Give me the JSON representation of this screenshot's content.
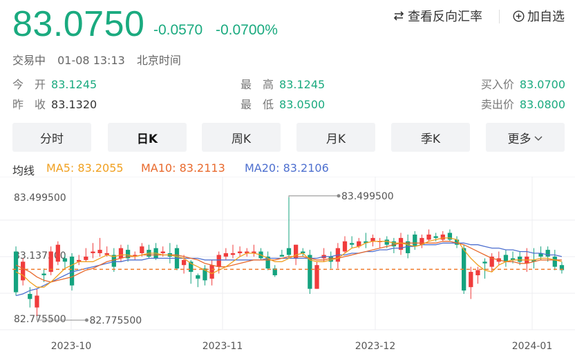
{
  "header": {
    "price": "83.0750",
    "change": "-0.0570",
    "change_pct": "-0.0700%",
    "actions": {
      "reverse_rate": "查看反向汇率",
      "add_watch": "加自选"
    },
    "status": "交易中",
    "datetime": "01-08 13:13",
    "timezone": "北京时间"
  },
  "quote": {
    "open_label": "今　开",
    "open": "83.1245",
    "prev_close_label": "昨　收",
    "prev_close": "83.1320",
    "high_label": "最　高",
    "high": "83.1245",
    "low_label": "最　低",
    "low": "83.0500",
    "bid_label": "买入价",
    "bid": "83.0700",
    "ask_label": "卖出价",
    "ask": "83.0800"
  },
  "tabs": [
    "分时",
    "日K",
    "周K",
    "月K",
    "季K",
    "更多"
  ],
  "active_tab": "日K",
  "ma_legend": {
    "title": "均线",
    "ma5": "MA5: 83.2055",
    "ma10": "MA10: 83.2113",
    "ma20": "MA20: 83.2106"
  },
  "colors": {
    "up": "#f03c3c",
    "down": "#14a37f",
    "ma5": "#f0a020",
    "ma10": "#e8692c",
    "ma20": "#4d6fcf",
    "brand": "#1aaa7f"
  },
  "chart_data": {
    "type": "candlestick",
    "ylim": [
      82.7755,
      83.4995
    ],
    "y_tick_labels": [
      "83.499500",
      "83.137500",
      "82.775500"
    ],
    "x_tick_labels": [
      "2023-10",
      "2023-11",
      "2023-12",
      "2024-01"
    ],
    "annotations": {
      "max_label": "83.499500",
      "min_label": "82.775500"
    },
    "reference_price": 83.075,
    "candles": [
      {
        "o": 83.18,
        "c": 82.94,
        "h": 83.21,
        "l": 82.92
      },
      {
        "o": 83.01,
        "c": 83.12,
        "h": 83.14,
        "l": 82.98
      },
      {
        "o": 82.93,
        "c": 82.9,
        "h": 82.97,
        "l": 82.85
      },
      {
        "o": 82.85,
        "c": 82.92,
        "h": 82.96,
        "l": 82.8
      },
      {
        "o": 83.05,
        "c": 83.04,
        "h": 83.08,
        "l": 83.0
      },
      {
        "o": 83.06,
        "c": 83.18,
        "h": 83.21,
        "l": 83.04
      },
      {
        "o": 83.12,
        "c": 83.22,
        "h": 83.24,
        "l": 83.1
      },
      {
        "o": 83.14,
        "c": 83.12,
        "h": 83.16,
        "l": 83.08
      },
      {
        "o": 83.15,
        "c": 82.98,
        "h": 83.17,
        "l": 82.95
      },
      {
        "o": 83.12,
        "c": 83.13,
        "h": 83.16,
        "l": 83.1
      },
      {
        "o": 83.13,
        "c": 83.15,
        "h": 83.2,
        "l": 83.12
      },
      {
        "o": 83.17,
        "c": 83.18,
        "h": 83.23,
        "l": 83.14
      },
      {
        "o": 83.17,
        "c": 83.19,
        "h": 83.26,
        "l": 83.15
      },
      {
        "o": 83.16,
        "c": 83.17,
        "h": 83.21,
        "l": 83.15
      },
      {
        "o": 83.16,
        "c": 83.09,
        "h": 83.2,
        "l": 83.06
      },
      {
        "o": 83.14,
        "c": 83.2,
        "h": 83.22,
        "l": 83.12
      },
      {
        "o": 83.19,
        "c": 83.14,
        "h": 83.22,
        "l": 83.12
      },
      {
        "o": 83.15,
        "c": 83.16,
        "h": 83.18,
        "l": 83.13
      },
      {
        "o": 83.17,
        "c": 83.21,
        "h": 83.23,
        "l": 83.15
      },
      {
        "o": 83.19,
        "c": 83.15,
        "h": 83.22,
        "l": 83.14
      },
      {
        "o": 83.2,
        "c": 83.14,
        "h": 83.23,
        "l": 83.13
      },
      {
        "o": 83.17,
        "c": 83.18,
        "h": 83.21,
        "l": 83.15
      },
      {
        "o": 83.17,
        "c": 83.15,
        "h": 83.23,
        "l": 83.11
      },
      {
        "o": 83.2,
        "c": 83.08,
        "h": 83.22,
        "l": 83.07
      },
      {
        "o": 83.1,
        "c": 83.13,
        "h": 83.16,
        "l": 83.05
      },
      {
        "o": 83.12,
        "c": 83.06,
        "h": 83.13,
        "l": 82.99
      },
      {
        "o": 83.04,
        "c": 83.02,
        "h": 83.05,
        "l": 82.97
      },
      {
        "o": 83.08,
        "c": 83.01,
        "h": 83.1,
        "l": 82.98
      },
      {
        "o": 83.02,
        "c": 83.1,
        "h": 83.13,
        "l": 82.98
      },
      {
        "o": 83.09,
        "c": 83.16,
        "h": 83.18,
        "l": 83.05
      },
      {
        "o": 83.15,
        "c": 83.17,
        "h": 83.2,
        "l": 83.13
      },
      {
        "o": 83.16,
        "c": 83.17,
        "h": 83.22,
        "l": 83.14
      },
      {
        "o": 83.17,
        "c": 83.18,
        "h": 83.21,
        "l": 83.15
      },
      {
        "o": 83.17,
        "c": 83.18,
        "h": 83.2,
        "l": 83.15
      },
      {
        "o": 83.17,
        "c": 83.18,
        "h": 83.22,
        "l": 83.15
      },
      {
        "o": 83.18,
        "c": 83.14,
        "h": 83.2,
        "l": 83.13
      },
      {
        "o": 83.15,
        "c": 83.08,
        "h": 83.18,
        "l": 83.07
      },
      {
        "o": 83.08,
        "c": 83.04,
        "h": 83.1,
        "l": 83.03
      },
      {
        "o": 83.16,
        "c": 83.15,
        "h": 83.19,
        "l": 83.15
      },
      {
        "o": 83.2,
        "c": 83.16,
        "h": 83.5,
        "l": 83.14
      },
      {
        "o": 83.14,
        "c": 83.22,
        "h": 83.22,
        "l": 83.1
      },
      {
        "o": 83.18,
        "c": 83.17,
        "h": 83.2,
        "l": 83.15
      },
      {
        "o": 83.16,
        "c": 82.96,
        "h": 83.19,
        "l": 82.93
      },
      {
        "o": 82.96,
        "c": 83.1,
        "h": 83.12,
        "l": 82.96
      },
      {
        "o": 83.14,
        "c": 83.16,
        "h": 83.2,
        "l": 83.12
      },
      {
        "o": 83.15,
        "c": 83.12,
        "h": 83.18,
        "l": 83.08
      },
      {
        "o": 83.12,
        "c": 83.2,
        "h": 83.23,
        "l": 83.08
      },
      {
        "o": 83.18,
        "c": 83.24,
        "h": 83.27,
        "l": 83.17
      },
      {
        "o": 83.23,
        "c": 83.22,
        "h": 83.27,
        "l": 83.2
      },
      {
        "o": 83.21,
        "c": 83.24,
        "h": 83.26,
        "l": 83.2
      },
      {
        "o": 83.24,
        "c": 83.23,
        "h": 83.29,
        "l": 83.2
      },
      {
        "o": 83.24,
        "c": 83.26,
        "h": 83.28,
        "l": 83.21
      },
      {
        "o": 83.24,
        "c": 83.24,
        "h": 83.26,
        "l": 83.2
      },
      {
        "o": 83.25,
        "c": 83.22,
        "h": 83.27,
        "l": 83.2
      },
      {
        "o": 83.24,
        "c": 83.21,
        "h": 83.26,
        "l": 83.17
      },
      {
        "o": 83.19,
        "c": 83.26,
        "h": 83.29,
        "l": 83.16
      },
      {
        "o": 83.24,
        "c": 83.17,
        "h": 83.28,
        "l": 83.14
      },
      {
        "o": 83.28,
        "c": 83.21,
        "h": 83.3,
        "l": 83.19
      },
      {
        "o": 83.22,
        "c": 83.26,
        "h": 83.28,
        "l": 83.2
      },
      {
        "o": 83.25,
        "c": 83.28,
        "h": 83.31,
        "l": 83.24
      },
      {
        "o": 83.27,
        "c": 83.26,
        "h": 83.29,
        "l": 83.24
      },
      {
        "o": 83.25,
        "c": 83.28,
        "h": 83.3,
        "l": 83.24
      },
      {
        "o": 83.29,
        "c": 83.25,
        "h": 83.31,
        "l": 83.24
      },
      {
        "o": 83.25,
        "c": 83.22,
        "h": 83.27,
        "l": 83.2
      },
      {
        "o": 83.2,
        "c": 82.95,
        "h": 83.22,
        "l": 82.93
      },
      {
        "o": 82.97,
        "c": 83.06,
        "h": 83.09,
        "l": 82.9
      },
      {
        "o": 83.04,
        "c": 83.07,
        "h": 83.09,
        "l": 82.99
      },
      {
        "o": 83.12,
        "c": 83.11,
        "h": 83.14,
        "l": 83.02
      },
      {
        "o": 83.09,
        "c": 83.15,
        "h": 83.17,
        "l": 83.06
      },
      {
        "o": 83.12,
        "c": 83.14,
        "h": 83.18,
        "l": 83.1
      },
      {
        "o": 83.16,
        "c": 83.12,
        "h": 83.19,
        "l": 83.09
      },
      {
        "o": 83.14,
        "c": 83.13,
        "h": 83.18,
        "l": 83.11
      },
      {
        "o": 83.15,
        "c": 83.12,
        "h": 83.18,
        "l": 83.1
      },
      {
        "o": 83.11,
        "c": 83.15,
        "h": 83.2,
        "l": 83.06
      },
      {
        "o": 83.13,
        "c": 83.12,
        "h": 83.2,
        "l": 83.08
      },
      {
        "o": 83.17,
        "c": 83.15,
        "h": 83.21,
        "l": 83.13
      },
      {
        "o": 83.19,
        "c": 83.15,
        "h": 83.21,
        "l": 83.12
      },
      {
        "o": 83.15,
        "c": 83.09,
        "h": 83.19,
        "l": 83.07
      },
      {
        "o": 83.1,
        "c": 83.07,
        "h": 83.12,
        "l": 83.05
      }
    ],
    "ma5": [
      83.06,
      83.04,
      83.0,
      82.97,
      82.97,
      83.0,
      83.04,
      83.08,
      83.1,
      83.12,
      83.12,
      83.12,
      83.14,
      83.16,
      83.15,
      83.16,
      83.16,
      83.15,
      83.16,
      83.17,
      83.17,
      83.16,
      83.16,
      83.15,
      83.14,
      83.11,
      83.09,
      83.07,
      83.05,
      83.07,
      83.09,
      83.12,
      83.15,
      83.17,
      83.17,
      83.16,
      83.14,
      83.12,
      83.12,
      83.14,
      83.16,
      83.17,
      83.13,
      83.12,
      83.12,
      83.13,
      83.14,
      83.17,
      83.2,
      83.21,
      83.23,
      83.24,
      83.24,
      83.24,
      83.23,
      83.23,
      83.22,
      83.21,
      83.22,
      83.24,
      83.25,
      83.26,
      83.26,
      83.25,
      83.19,
      83.14,
      83.1,
      83.07,
      83.06,
      83.1,
      83.12,
      83.13,
      83.13,
      83.13,
      83.13,
      83.14,
      83.14,
      83.13,
      83.12
    ],
    "ma10": [
      83.1,
      83.08,
      83.06,
      83.03,
      83.01,
      83.0,
      83.01,
      83.02,
      83.03,
      83.05,
      83.07,
      83.08,
      83.1,
      83.12,
      83.13,
      83.14,
      83.15,
      83.15,
      83.16,
      83.16,
      83.16,
      83.16,
      83.16,
      83.16,
      83.15,
      83.14,
      83.13,
      83.11,
      83.1,
      83.09,
      83.09,
      83.1,
      83.11,
      83.12,
      83.13,
      83.13,
      83.13,
      83.13,
      83.14,
      83.15,
      83.15,
      83.15,
      83.14,
      83.13,
      83.13,
      83.14,
      83.14,
      83.15,
      83.16,
      83.17,
      83.18,
      83.19,
      83.2,
      83.21,
      83.22,
      83.23,
      83.23,
      83.23,
      83.23,
      83.23,
      83.23,
      83.24,
      83.24,
      83.23,
      83.22,
      83.2,
      83.18,
      83.16,
      83.14,
      83.13,
      83.12,
      83.12,
      83.11,
      83.11,
      83.12,
      83.13,
      83.13,
      83.13,
      83.13
    ],
    "ma20": [
      82.92,
      82.93,
      82.95,
      82.96,
      82.98,
      83.0,
      83.02,
      83.04,
      83.06,
      83.07,
      83.08,
      83.09,
      83.1,
      83.11,
      83.12,
      83.12,
      83.13,
      83.13,
      83.13,
      83.14,
      83.14,
      83.14,
      83.14,
      83.14,
      83.14,
      83.14,
      83.14,
      83.13,
      83.13,
      83.13,
      83.13,
      83.13,
      83.13,
      83.13,
      83.13,
      83.13,
      83.14,
      83.14,
      83.14,
      83.14,
      83.14,
      83.14,
      83.14,
      83.14,
      83.15,
      83.15,
      83.16,
      83.16,
      83.17,
      83.17,
      83.18,
      83.18,
      83.19,
      83.19,
      83.2,
      83.2,
      83.21,
      83.21,
      83.22,
      83.22,
      83.22,
      83.23,
      83.23,
      83.23,
      83.23,
      83.22,
      83.22,
      83.21,
      83.2,
      83.2,
      83.19,
      83.19,
      83.18,
      83.18,
      83.17,
      83.17,
      83.16,
      83.16,
      83.15
    ]
  }
}
